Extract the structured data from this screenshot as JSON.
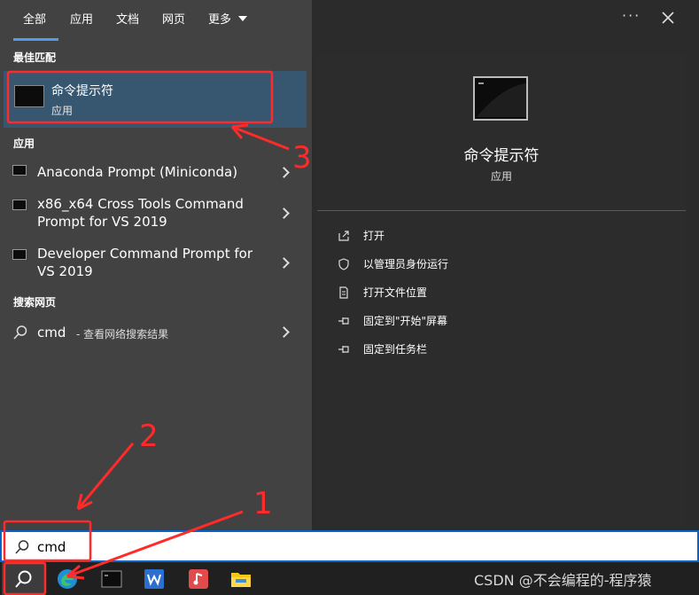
{
  "tabs": [
    {
      "label": "全部"
    },
    {
      "label": "应用"
    },
    {
      "label": "文档"
    },
    {
      "label": "网页"
    },
    {
      "label": "更多"
    }
  ],
  "sections": {
    "best_match": "最佳匹配",
    "apps": "应用",
    "search_web": "搜索网页"
  },
  "best_match": {
    "title": "命令提示符",
    "subtitle": "应用"
  },
  "apps": [
    {
      "line1": "Anaconda Prompt (Miniconda)",
      "line2": ""
    },
    {
      "line1": "x86_x64 Cross Tools Command",
      "line2": "Prompt for VS 2019"
    },
    {
      "line1": "Developer Command Prompt for",
      "line2": "VS 2019"
    }
  ],
  "web_search": {
    "query": "cmd",
    "suffix": "- 查看网络搜索结果"
  },
  "preview": {
    "title": "命令提示符",
    "subtitle": "应用"
  },
  "actions": [
    {
      "label": "打开",
      "icon": "open-icon"
    },
    {
      "label": "以管理员身份运行",
      "icon": "shield-icon"
    },
    {
      "label": "打开文件位置",
      "icon": "file-location-icon"
    },
    {
      "label": "固定到\"开始\"屏幕",
      "icon": "pin-icon"
    },
    {
      "label": "固定到任务栏",
      "icon": "pin-icon"
    }
  ],
  "search_box": {
    "value": "cmd"
  },
  "annotations": [
    "1",
    "2",
    "3"
  ],
  "watermark": "CSDN @不会编程的-程序猿",
  "colors": {
    "accent": "#0a64c8",
    "selection": "#37566f",
    "annotation": "#ff2a2a"
  }
}
